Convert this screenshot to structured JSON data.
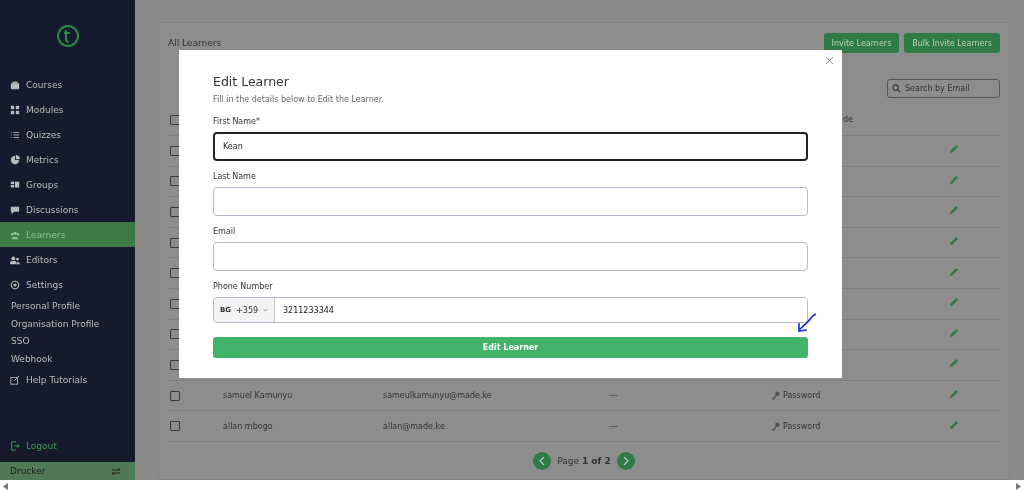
{
  "sidebar": {
    "items": [
      {
        "label": "Courses",
        "kind": "main",
        "selected": false
      },
      {
        "label": "Modules",
        "kind": "main",
        "selected": false
      },
      {
        "label": "Quizzes",
        "kind": "main",
        "selected": false
      },
      {
        "label": "Metrics",
        "kind": "main",
        "selected": false
      },
      {
        "label": "Groups",
        "kind": "main",
        "selected": false
      },
      {
        "label": "Discussions",
        "kind": "main",
        "selected": false
      },
      {
        "label": "Learners",
        "kind": "main",
        "selected": true
      },
      {
        "label": "Editors",
        "kind": "main",
        "selected": false
      },
      {
        "label": "Settings",
        "kind": "main",
        "selected": false
      },
      {
        "label": "Personal Profile",
        "kind": "sub",
        "selected": false
      },
      {
        "label": "Organisation Profile",
        "kind": "sub",
        "selected": false
      },
      {
        "label": "SSO",
        "kind": "sub",
        "selected": false
      },
      {
        "label": "Webhook",
        "kind": "sub",
        "selected": false
      },
      {
        "label": "Help Tutorials",
        "kind": "main",
        "selected": false
      }
    ],
    "logout": "Logout",
    "account": "Drucker"
  },
  "page": {
    "title": "All Learners",
    "buttons": [
      "Invite Learners",
      "Bulk Invite Learners"
    ],
    "search": {
      "placeholder": "Search by Email"
    },
    "table": {
      "select_all_checked": false,
      "columns": [
        "de"
      ],
      "rows": [
        {
          "checked": false
        },
        {
          "checked": false
        },
        {
          "checked": false
        },
        {
          "checked": false
        },
        {
          "checked": false
        },
        {
          "checked": false
        },
        {
          "checked": false
        },
        {
          "checked": false
        },
        {
          "checked": false,
          "name": "samuel Kamunyu",
          "email": "sameulkamunyu@made.ke",
          "column_3": "---",
          "column_4": "Password"
        },
        {
          "checked": false,
          "name": "allan mbogo",
          "email": "allan@made.ke",
          "column_3": "---",
          "column_4": "Password"
        }
      ]
    },
    "pagination": {
      "prefix": "Page",
      "current": "1 of 2"
    }
  },
  "modal": {
    "title": "Edit Learner",
    "subtitle": "Fill in the details below to Edit the Learner.",
    "fields": [
      {
        "label": "First Name*",
        "value": "Kean",
        "focused": true
      },
      {
        "label": "Last Name",
        "focused": false
      },
      {
        "label": "Email",
        "focused": false
      }
    ],
    "phone": {
      "label": "Phone Number",
      "country": "BG",
      "code": "+359",
      "value": "3211233344"
    },
    "submit": "Edit Learner"
  }
}
